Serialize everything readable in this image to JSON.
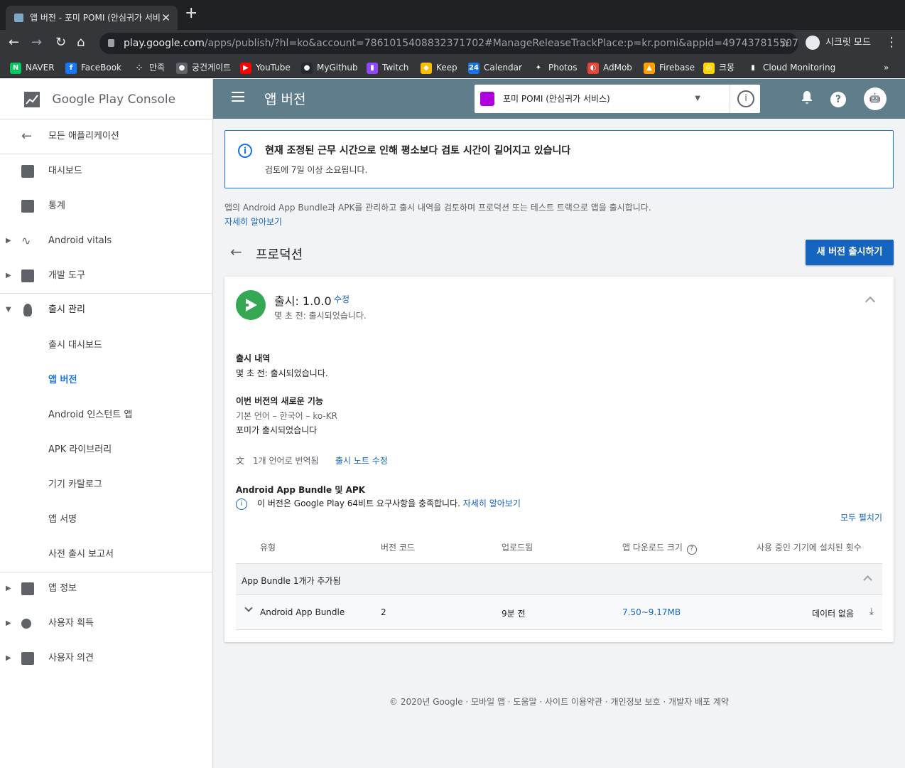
{
  "browser": {
    "tab_title": "앱 버전 - 포미 POMI (안심귀가 서비",
    "url_host": "play.google.com",
    "url_rest": "/apps/publish/?hl=ko&account=7861015408832371702#ManageReleaseTrackPlace:p=kr.pomi&appid=497437815507450285...",
    "incognito_label": "시크릿 모드",
    "bookmarks": [
      {
        "label": "NAVER",
        "color": "#03c75a",
        "glyph": "N"
      },
      {
        "label": "FaceBook",
        "color": "#1877f2",
        "glyph": "f"
      },
      {
        "label": "만족",
        "color": "#35363a",
        "glyph": "⁘"
      },
      {
        "label": "궁건게이트",
        "color": "#5f6368",
        "glyph": "●"
      },
      {
        "label": "YouTube",
        "color": "#ff0000",
        "glyph": "▶"
      },
      {
        "label": "MyGithub",
        "color": "#24292e",
        "glyph": "●"
      },
      {
        "label": "Twitch",
        "color": "#9146ff",
        "glyph": "▮"
      },
      {
        "label": "Keep",
        "color": "#fbbc04",
        "glyph": "◆"
      },
      {
        "label": "Calendar",
        "color": "#1a73e8",
        "glyph": "24"
      },
      {
        "label": "Photos",
        "color": "#35363a",
        "glyph": "✦"
      },
      {
        "label": "AdMob",
        "color": "#ea4335",
        "glyph": "◐"
      },
      {
        "label": "Firebase",
        "color": "#ffa000",
        "glyph": "▲"
      },
      {
        "label": "크몽",
        "color": "#ffd400",
        "glyph": "◎"
      },
      {
        "label": "Cloud Monitoring",
        "color": "#35363a",
        "glyph": "▮"
      }
    ],
    "more_glyph": "»"
  },
  "sidebar": {
    "logo_text": "Google Play Console",
    "back_label": "모든 애플리케이션",
    "items": [
      {
        "label": "대시보드"
      },
      {
        "label": "통계"
      },
      {
        "label": "Android vitals"
      },
      {
        "label": "개발 도구"
      },
      {
        "label": "출시 관리"
      },
      {
        "label": "출시 대시보드"
      },
      {
        "label": "앱 버전"
      },
      {
        "label": "Android 인스턴트 앱"
      },
      {
        "label": "APK 라이브러리"
      },
      {
        "label": "기기 카탈로그"
      },
      {
        "label": "앱 서명"
      },
      {
        "label": "사전 출시 보고서"
      },
      {
        "label": "앱 정보"
      },
      {
        "label": "사용자 획득"
      },
      {
        "label": "사용자 의견"
      }
    ]
  },
  "header": {
    "title": "앱 버전",
    "app_name": "포미 POMI (안심귀가 서비스)",
    "bell_glyph": "🔔",
    "help_glyph": "?"
  },
  "notice": {
    "title": "현재 조정된 근무 시간으로 인해 평소보다 검토 시간이 길어지고 있습니다",
    "body": "검토에 7일 이상 소요됩니다."
  },
  "intro": {
    "text": "앱의 Android App Bundle과 APK를 관리하고 출시 내역을 검토하며 프로덕션 또는 테스트 트랙으로 앱을 출시합니다.",
    "learn_more": "자세히 알아보기"
  },
  "track": {
    "title": "프로덕션",
    "new_release_button": "새 버전 출시하기"
  },
  "release": {
    "title": "출시: 1.0.0",
    "edit_label": "수정",
    "subtitle": "몇 초 전: 출시되었습니다.",
    "history_heading": "출시 내역",
    "history_text": "몇 초 전: 출시되었습니다.",
    "whatsnew_heading": "이번 버전의 새로운 기능",
    "whatsnew_lang": "기본 언어 – 한국어 – ko-KR",
    "whatsnew_text": "포미가 출시되었습니다",
    "translated_label": "1개 언어로 번역됨",
    "edit_notes_label": "출시 노트 수정",
    "bundle_heading": "Android App Bundle 및 APK",
    "requirement_text": "이 버전은 Google Play 64비트 요구사항을 충족합니다.",
    "requirement_link": "자세히 알아보기",
    "expand_all": "모두 펼치기"
  },
  "table": {
    "headers": [
      "유형",
      "버전 코드",
      "업로드됨",
      "앱 다운로드 크기",
      "사용 중인 기기에 설치된 횟수"
    ],
    "group_label": "App Bundle 1개가 추가됨",
    "row": {
      "type": "Android App Bundle",
      "version_code": "2",
      "uploaded": "9분 전",
      "size": "7.50~9.17MB",
      "installs": "데이터 없음"
    }
  },
  "footer": {
    "text": "© 2020년 Google · 모바일 앱 · 도움말 · 사이트 이용약관 · 개인정보 보호 · 개발자 배포 계약"
  }
}
